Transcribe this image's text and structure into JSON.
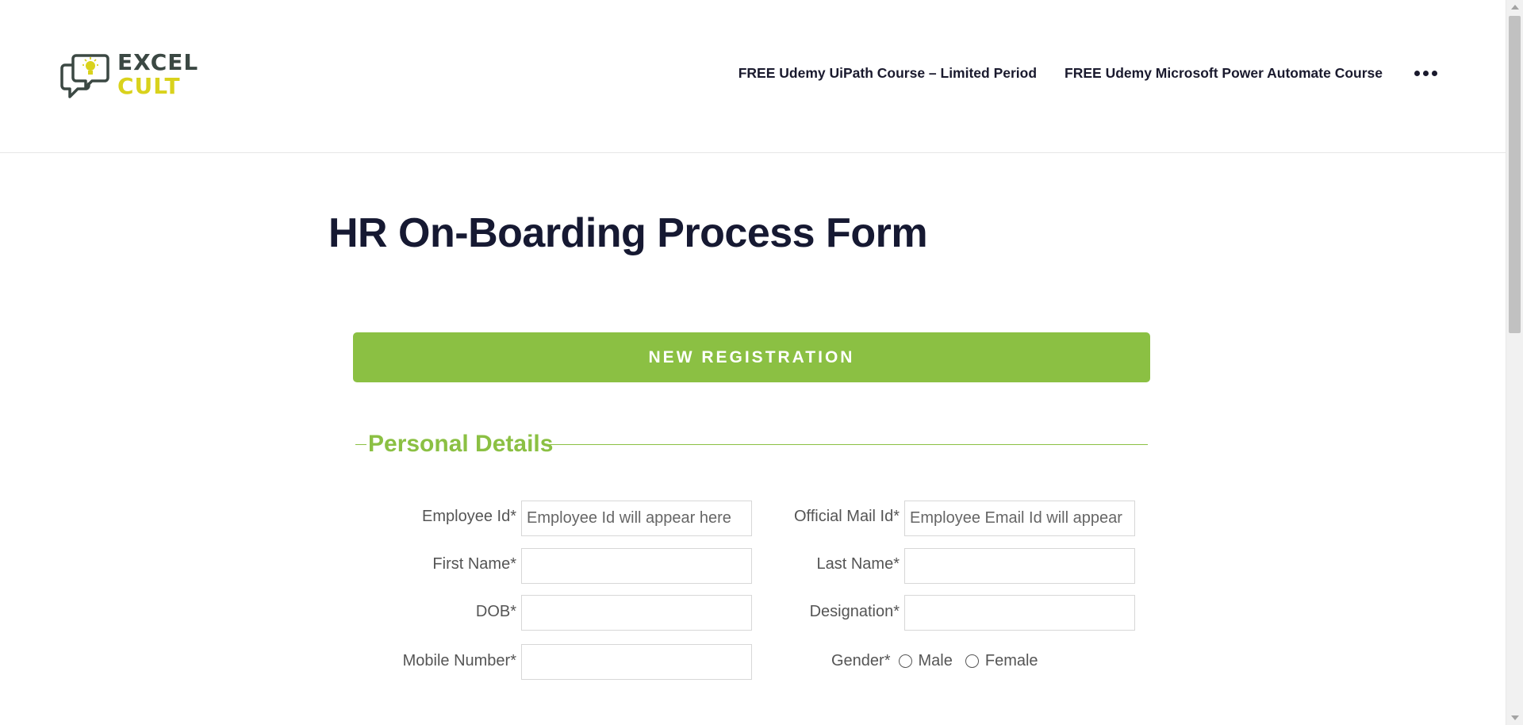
{
  "header": {
    "logo": {
      "line1": "EXCEL",
      "line2": "CULT"
    },
    "nav": [
      {
        "label": "FREE Udemy UiPath Course – Limited Period"
      },
      {
        "label": "FREE Udemy Microsoft Power Automate Course"
      }
    ]
  },
  "page": {
    "title": "HR On-Boarding Process Form",
    "banner": "NEW REGISTRATION",
    "section_title": "Personal Details"
  },
  "form": {
    "employee_id": {
      "label": "Employee Id*",
      "placeholder": "Employee Id will appear here"
    },
    "official_mail": {
      "label": "Official Mail Id*",
      "placeholder": "Employee Email Id will appear"
    },
    "first_name": {
      "label": "First Name*",
      "value": ""
    },
    "last_name": {
      "label": "Last Name*",
      "value": ""
    },
    "dob": {
      "label": "DOB*",
      "value": ""
    },
    "designation": {
      "label": "Designation*",
      "value": ""
    },
    "mobile": {
      "label": "Mobile Number*",
      "value": ""
    },
    "gender": {
      "label": "Gender*",
      "options": [
        "Male",
        "Female"
      ]
    }
  },
  "colors": {
    "accent": "#8bc043",
    "title": "#161932",
    "logo_dark": "#3b4843",
    "logo_yellow": "#d9d21c"
  }
}
